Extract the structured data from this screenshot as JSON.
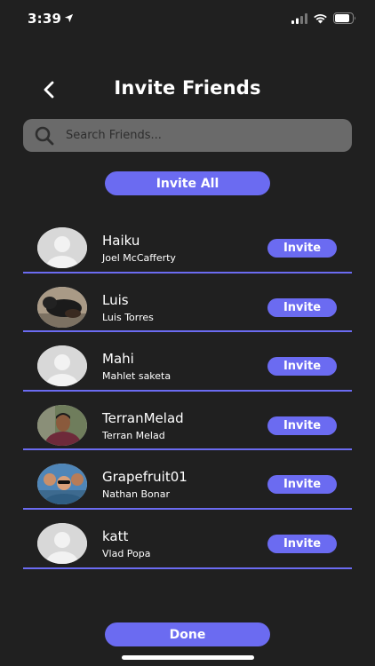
{
  "status": {
    "time": "3:39"
  },
  "header": {
    "title": "Invite Friends"
  },
  "search": {
    "placeholder": "Search Friends..."
  },
  "actions": {
    "invite_all": "Invite All",
    "done": "Done"
  },
  "friends": [
    {
      "username": "Haiku",
      "fullname": "Joel McCafferty",
      "avatar": "default-avatar",
      "action": "Invite"
    },
    {
      "username": "Luis",
      "fullname": "Luis Torres",
      "avatar": "dog-photo",
      "action": "Invite"
    },
    {
      "username": "Mahi",
      "fullname": "Mahlet saketa",
      "avatar": "default-avatar",
      "action": "Invite"
    },
    {
      "username": "TerranMelad",
      "fullname": "Terran Melad",
      "avatar": "person-photo",
      "action": "Invite"
    },
    {
      "username": "Grapefruit01",
      "fullname": "Nathan Bonar",
      "avatar": "group-photo",
      "action": "Invite"
    },
    {
      "username": "katt",
      "fullname": "Vlad Popa",
      "avatar": "default-avatar",
      "action": "Invite"
    }
  ],
  "colors": {
    "background": "#202020",
    "accent": "#6b6bf1",
    "search_bg": "#6a6a6a"
  }
}
